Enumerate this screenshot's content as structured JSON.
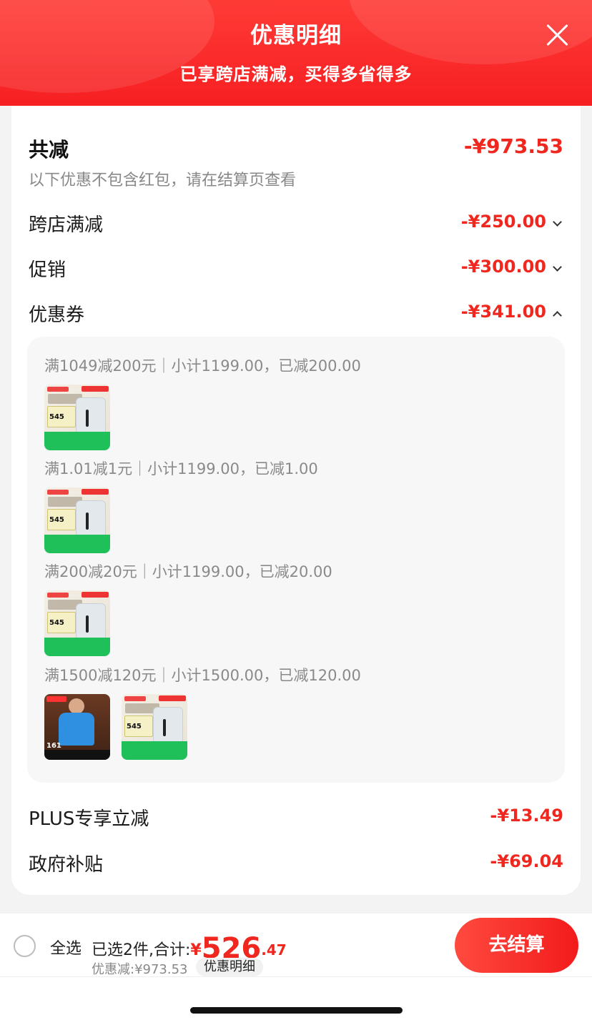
{
  "header": {
    "title": "优惠明细",
    "subtitle": "已享跨店满减，买得多省得多"
  },
  "card": {
    "total_label": "共减",
    "total_amount": "-¥973.53",
    "note": "以下优惠不包含红包，请在结算页查看",
    "rows": [
      {
        "label": "跨店满减",
        "amount": "-¥250.00",
        "chevron": "chevron-down"
      },
      {
        "label": "促销",
        "amount": "-¥300.00",
        "chevron": "chevron-down"
      },
      {
        "label": "优惠券",
        "amount": "-¥341.00",
        "chevron": "chevron-up"
      }
    ],
    "coupons": [
      {
        "title": "满1049减200元｜小计1199.00，已减200.00"
      },
      {
        "title": "满1.01减1元｜小计1199.00，已减1.00"
      },
      {
        "title": "满200减20元｜小计1199.00，已减20.00"
      },
      {
        "title": "满1500减120元｜小计1500.00，已减120.00"
      }
    ],
    "plus": {
      "label": "PLUS专享立减",
      "amount": "-¥13.49"
    },
    "gov": {
      "label": "政府补贴",
      "amount": "-¥69.04"
    }
  },
  "bottom": {
    "select_all": "全选",
    "summary_prefix": "已选2件,合计:",
    "currency": "¥",
    "total_int": "526",
    "total_dec": ".47",
    "discount_line": "优惠减:¥973.53",
    "detail_chip": "优惠明细",
    "checkout": "去结算"
  },
  "colors": {
    "accent": "#f0271e",
    "header_red": "#f61f22"
  }
}
